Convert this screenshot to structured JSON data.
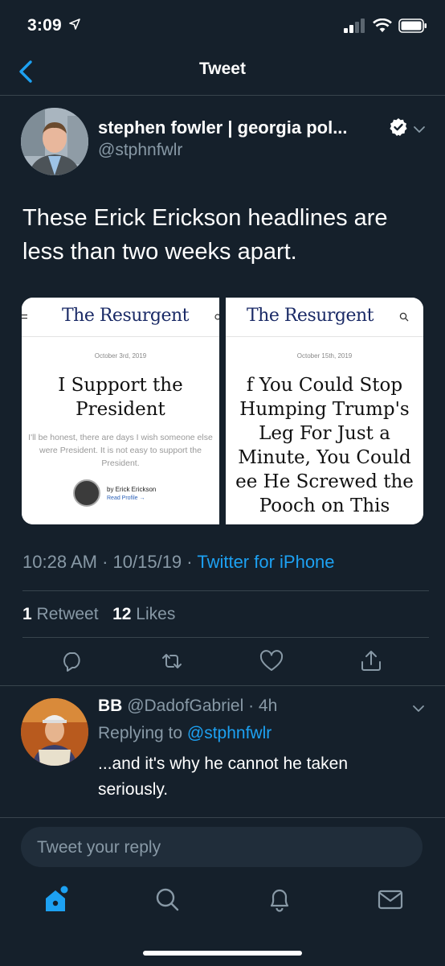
{
  "status_bar": {
    "time": "3:09"
  },
  "nav": {
    "title": "Tweet"
  },
  "tweet": {
    "author_name": "stephen fowler | georgia pol...",
    "handle": "@stphnfwlr",
    "text": "These Erick Erickson headlines are less than two weeks apart.",
    "time": "10:28 AM",
    "date": "10/15/19",
    "source": "Twitter for iPhone",
    "retweets_count": "1",
    "retweets_label": "Retweet",
    "likes_count": "12",
    "likes_label": "Likes"
  },
  "media": {
    "left": {
      "logo": "The Resurgent",
      "date": "October 3rd, 2019",
      "headline_line1": "I Support the",
      "headline_line2": "President",
      "excerpt": "I'll be honest, there are days I wish someone else were President. It is not easy to support the President.",
      "byline": "by Erick Erickson",
      "read_profile": "Read Profile →"
    },
    "right": {
      "logo": "The Resurgent",
      "date": "October 15th, 2019",
      "headline_lines": [
        "f You Could Stop",
        "Humping Trump's",
        "Leg For Just a",
        "Minute, You Could",
        "ee He Screwed the",
        "Pooch on This"
      ]
    }
  },
  "reply": {
    "name": "BB",
    "handle": "@DadofGabriel",
    "time": "4h",
    "replying_label": "Replying to",
    "replying_to": "@stphnfwlr",
    "text": "...and it's why he cannot he taken seriously."
  },
  "composer": {
    "placeholder": "Tweet your reply"
  },
  "tabs": [
    "home-icon",
    "search-icon",
    "notifications-icon",
    "messages-icon"
  ],
  "colors": {
    "background": "#15202b",
    "accent": "#1da1f2",
    "secondary_text": "#8899a6",
    "divider": "#38444d"
  }
}
